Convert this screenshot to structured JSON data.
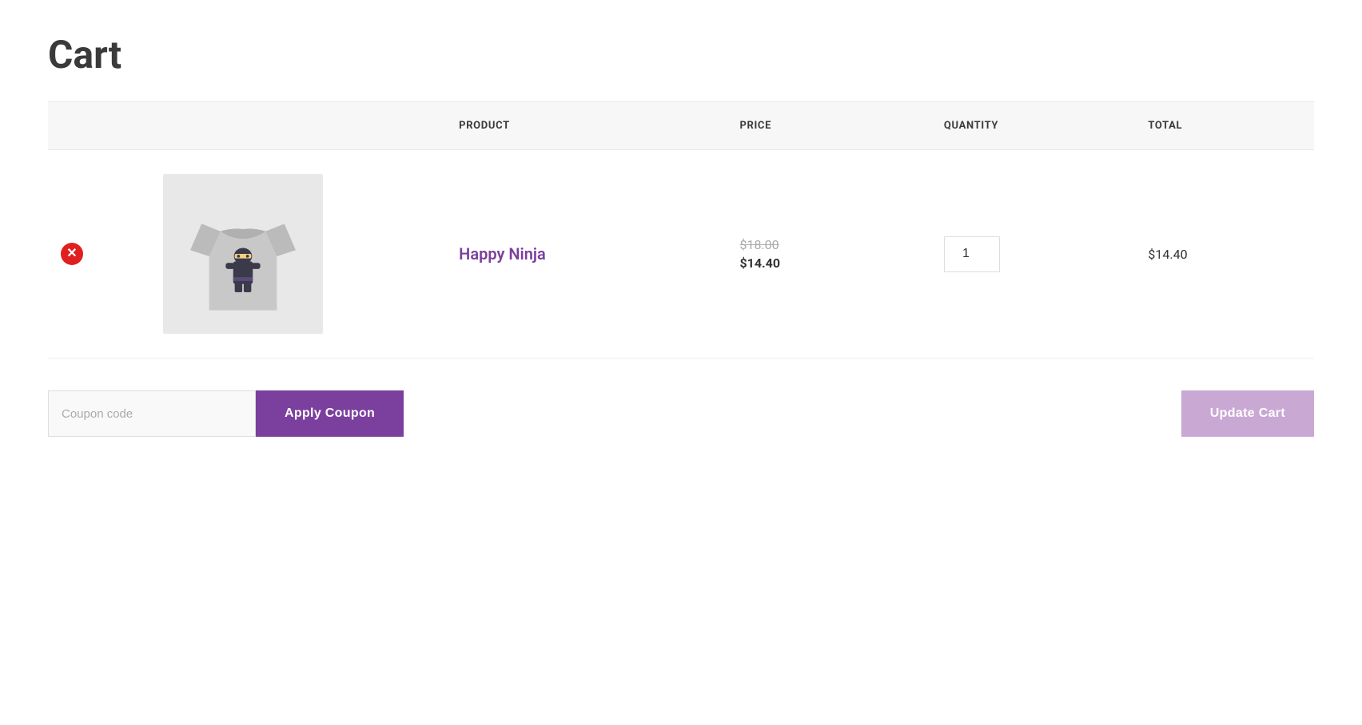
{
  "page": {
    "title": "Cart"
  },
  "table": {
    "headers": {
      "remove": "",
      "image": "",
      "product": "PRODUCT",
      "price": "PRICE",
      "quantity": "QUANTITY",
      "total": "TOTAL"
    },
    "rows": [
      {
        "product_name": "Happy Ninja",
        "price_original": "$18.00",
        "price_sale": "$14.40",
        "quantity": "1",
        "total": "$14.40"
      }
    ]
  },
  "actions": {
    "coupon_placeholder": "Coupon code",
    "coupon_value": "",
    "apply_coupon_label": "Apply Coupon",
    "update_cart_label": "Update Cart"
  },
  "colors": {
    "accent_purple": "#7b3f9e",
    "remove_red": "#e02020",
    "update_cart_muted": "#c9a8d4"
  }
}
